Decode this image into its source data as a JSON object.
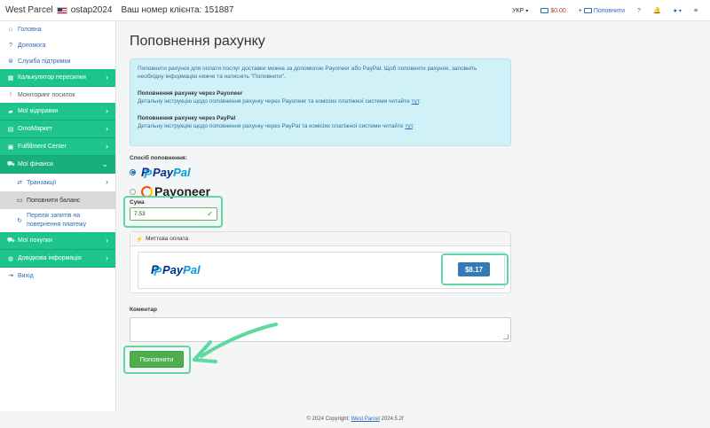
{
  "header": {
    "brand": "West Parcel",
    "username": "ostap2024",
    "client_number": "Ваш номер клієнта: 151887",
    "language": "УКР",
    "balance": "$0.00",
    "pay_link": "Поповнити",
    "help": "?"
  },
  "sidebar": {
    "items": [
      {
        "label": "Головна",
        "icon": "home-icon"
      },
      {
        "label": "Допомога",
        "icon": "question-icon"
      },
      {
        "label": "Служба підтримки",
        "icon": "lifebuoy-icon"
      },
      {
        "label": "Калькулятор пересилки",
        "icon": "calculator-icon"
      },
      {
        "label": "Моніторинг посилок",
        "icon": "exclamation-icon"
      },
      {
        "label": "Мої відправки",
        "icon": "truck-icon"
      },
      {
        "label": "OmoMapкет",
        "icon": "bag-icon"
      },
      {
        "label": "Fulfillment Center",
        "icon": "box-icon"
      },
      {
        "label": "Мої фінанси",
        "icon": "cart-icon"
      },
      {
        "label": "Транзакції",
        "icon": "exchange-icon"
      },
      {
        "label": "Поповнити баланс",
        "icon": "card-icon"
      },
      {
        "label": "Перелік запитів на повернення платежу",
        "icon": "return-icon"
      },
      {
        "label": "Мої покупки",
        "icon": "cart-icon"
      },
      {
        "label": "Довідкова інформація",
        "icon": "globe-icon"
      },
      {
        "label": "Вихід",
        "icon": "logout-icon"
      }
    ]
  },
  "main": {
    "title": "Поповнення рахунку",
    "info": {
      "intro": "Поповнити рахунок для оплати послуг доставки можна за допомогою Payoneer або PayPal. Щоб поповнити рахунок, заповніть необхідну інформацію нижче та натисніть \"Поповнити\".",
      "payoneer_title": "Поповнення рахунку через Payoneer",
      "payoneer_text": "Детальну інструкцію щодо поповнення рахунку через Payoneer та комісіях платіжної системи читайте",
      "paypal_title": "Поповнення рахунку через PayPal",
      "paypal_text": "Детальну інструкцію щодо поповнення рахунку через PayPal та комісіях платіжної системи читайте",
      "link_word": "тут",
      "link_dot": "."
    },
    "method_label": "Спосіб поповнення:",
    "methods": [
      {
        "pay": "Pay",
        "pal": "Pal",
        "selected": true
      },
      {
        "name": "Payoneer",
        "selected": false
      }
    ],
    "amount_label": "Сума",
    "amount_value": "7.53",
    "instant_label": "Миттєва оплата",
    "instant_price": "$8.17",
    "comment_label": "Коментар",
    "submit_label": "Поповнити"
  },
  "footer": {
    "prefix": "© 2024 Copyright:",
    "link": "West Parcel",
    "version": "2024.5.2f"
  },
  "colors": {
    "sidebar_green": "#1ec58b",
    "highlight_outline": "#5ed8a0",
    "info_bg": "#d1f1f8",
    "submit_green": "#4cae4c",
    "price_blue": "#337ab7"
  }
}
